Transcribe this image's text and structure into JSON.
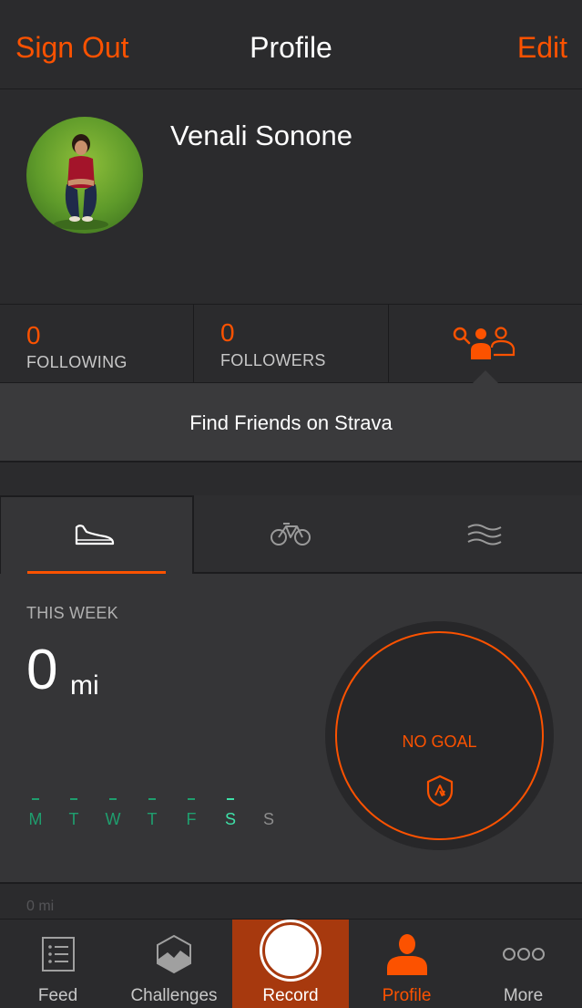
{
  "navbar": {
    "left_label": "Sign Out",
    "title": "Profile",
    "right_label": "Edit"
  },
  "athlete": {
    "name": "Venali Sonone"
  },
  "stats": {
    "following_count": "0",
    "following_label": "FOLLOWING",
    "followers_count": "0",
    "followers_label": "FOLLOWERS",
    "find_icon": "find-friends-icon"
  },
  "find_friends": {
    "label": "Find Friends on Strava"
  },
  "sport_tabs": [
    {
      "icon": "run-shoe-icon",
      "active": true
    },
    {
      "icon": "bicycle-icon",
      "active": false
    },
    {
      "icon": "swim-waves-icon",
      "active": false
    }
  ],
  "week": {
    "title": "THIS WEEK",
    "distance": "0",
    "unit": "mi",
    "days": [
      {
        "letter": "M",
        "state": "past"
      },
      {
        "letter": "T",
        "state": "past"
      },
      {
        "letter": "W",
        "state": "past"
      },
      {
        "letter": "T",
        "state": "past"
      },
      {
        "letter": "F",
        "state": "past"
      },
      {
        "letter": "S",
        "state": "today"
      },
      {
        "letter": "S",
        "state": "future"
      }
    ],
    "goal_label": "NO GOAL",
    "goal_icon": "strava-shield-icon"
  },
  "below": {
    "text": "0 mi"
  },
  "tabbar": [
    {
      "label": "Feed",
      "icon": "feed-list-icon"
    },
    {
      "label": "Challenges",
      "icon": "challenges-icon"
    },
    {
      "label": "Record",
      "icon": "record-button-icon"
    },
    {
      "label": "Profile",
      "icon": "profile-icon"
    },
    {
      "label": "More",
      "icon": "more-dots-icon"
    }
  ],
  "colors": {
    "accent": "#fc5200",
    "record_bg": "#a7390e",
    "day_past": "#1f9e6e",
    "day_today": "#3fe0a8",
    "day_future": "#8c8c8c",
    "background": "#2b2b2d"
  }
}
